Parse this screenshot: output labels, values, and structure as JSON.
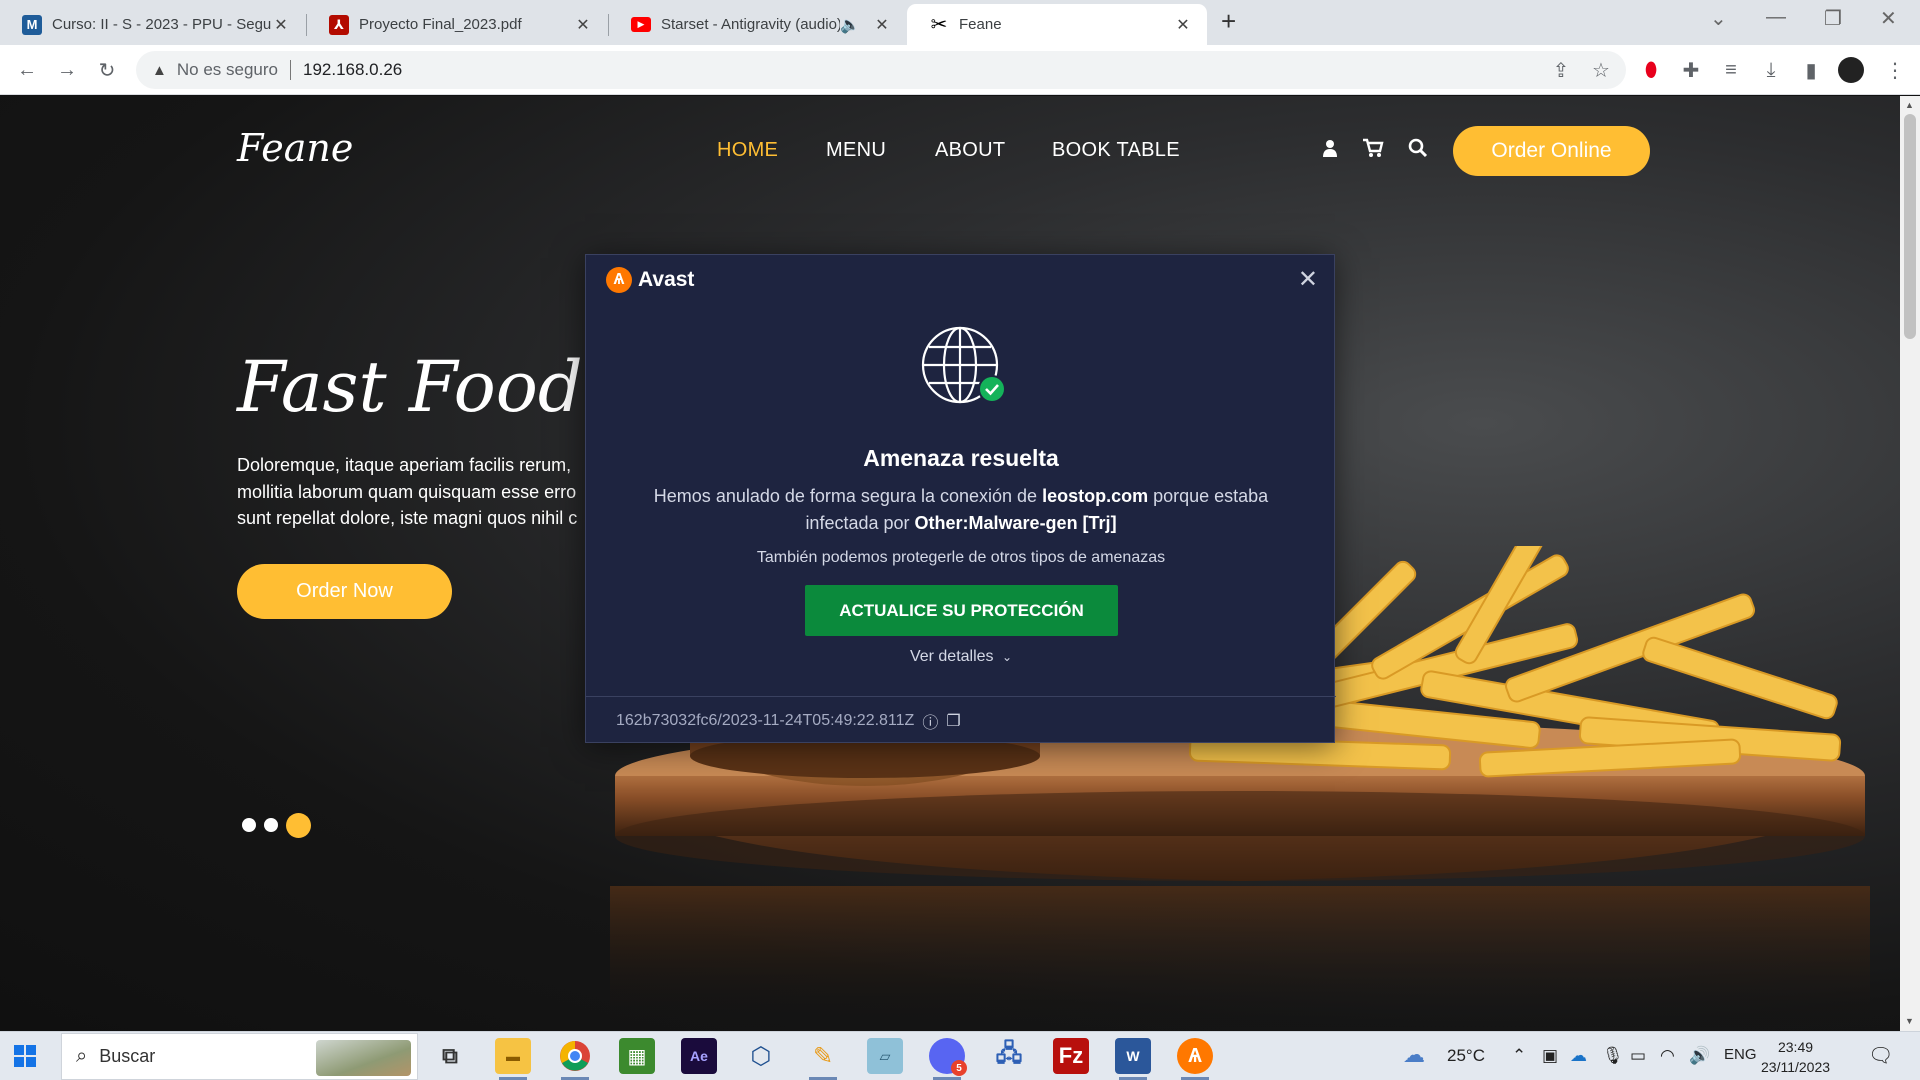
{
  "browser": {
    "tabs": [
      {
        "title": "Curso: II - S - 2023 - PPU - Segu",
        "favicon": "moodle-icon",
        "active": false
      },
      {
        "title": "Proyecto Final_2023.pdf",
        "favicon": "pdf-icon",
        "active": false
      },
      {
        "title": "Starset - Antigravity (audio)",
        "favicon": "youtube-icon",
        "active": false
      },
      {
        "title": "Feane",
        "favicon": "feane-icon",
        "active": true
      }
    ],
    "address": {
      "security_label": "No es seguro",
      "url": "192.168.0.26"
    }
  },
  "site": {
    "brand": "Feane",
    "nav": [
      {
        "label": "HOME",
        "active": true
      },
      {
        "label": "MENU",
        "active": false
      },
      {
        "label": "ABOUT",
        "active": false
      },
      {
        "label": "BOOK TABLE",
        "active": false
      }
    ],
    "order_online": "Order Online",
    "hero": {
      "title": "Fast Food Res",
      "lines": [
        "Doloremque, itaque aperiam facilis rerum,",
        "mollitia laborum quam quisquam esse erro",
        "sunt repellat dolore, iste magni quos nihil c"
      ],
      "order_now": "Order Now"
    },
    "carousel": {
      "count": 3,
      "active_index": 2
    },
    "accent_color": "#ffbe33"
  },
  "avast": {
    "brand": "Avast",
    "title": "Amenaza resuelta",
    "desc_pre": "Hemos anulado de forma segura la conexión de",
    "domain": "leostop.com",
    "desc_mid": "porque estaba",
    "desc_mid2": "infectada por",
    "threat": "Other:Malware-gen [Trj]",
    "sub": "También podemos protegerle de otros tipos de amenazas",
    "upgrade_label": "ACTUALICE SU PROTECCIÓN",
    "details_label": "Ver detalles",
    "footer_id": "162b73032fc6/2023-11-24T05:49:22.811Z",
    "accent_color": "#0b8a3c"
  },
  "taskbar": {
    "search_placeholder": "Buscar",
    "weather": "25°C",
    "language": "ENG",
    "time": "23:49",
    "date": "23/11/2023",
    "apps": [
      "file-explorer",
      "chrome",
      "minecraft",
      "after-effects",
      "virtualbox",
      "paint",
      "notes",
      "discord",
      "network",
      "filezilla",
      "word",
      "avast"
    ],
    "discord_badge": "5"
  }
}
